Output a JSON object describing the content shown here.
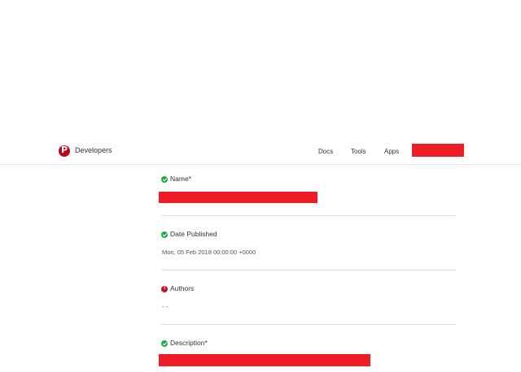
{
  "header": {
    "brand": "Developers",
    "nav": [
      "Docs",
      "Tools",
      "Apps"
    ]
  },
  "fields": {
    "name": {
      "label": "Name*",
      "status": "valid"
    },
    "date_published": {
      "label": "Date Published",
      "value": "Mon, 05 Feb 2018 00:00:00 +0000",
      "status": "valid"
    },
    "authors": {
      "label": "Authors",
      "value": "- -",
      "status": "error"
    },
    "description": {
      "label": "Description*",
      "status": "valid"
    }
  },
  "colors": {
    "brand_red": "#bd081c",
    "redaction": "#ee1c25",
    "valid_green": "#19a84a",
    "error_red": "#c8102e"
  }
}
